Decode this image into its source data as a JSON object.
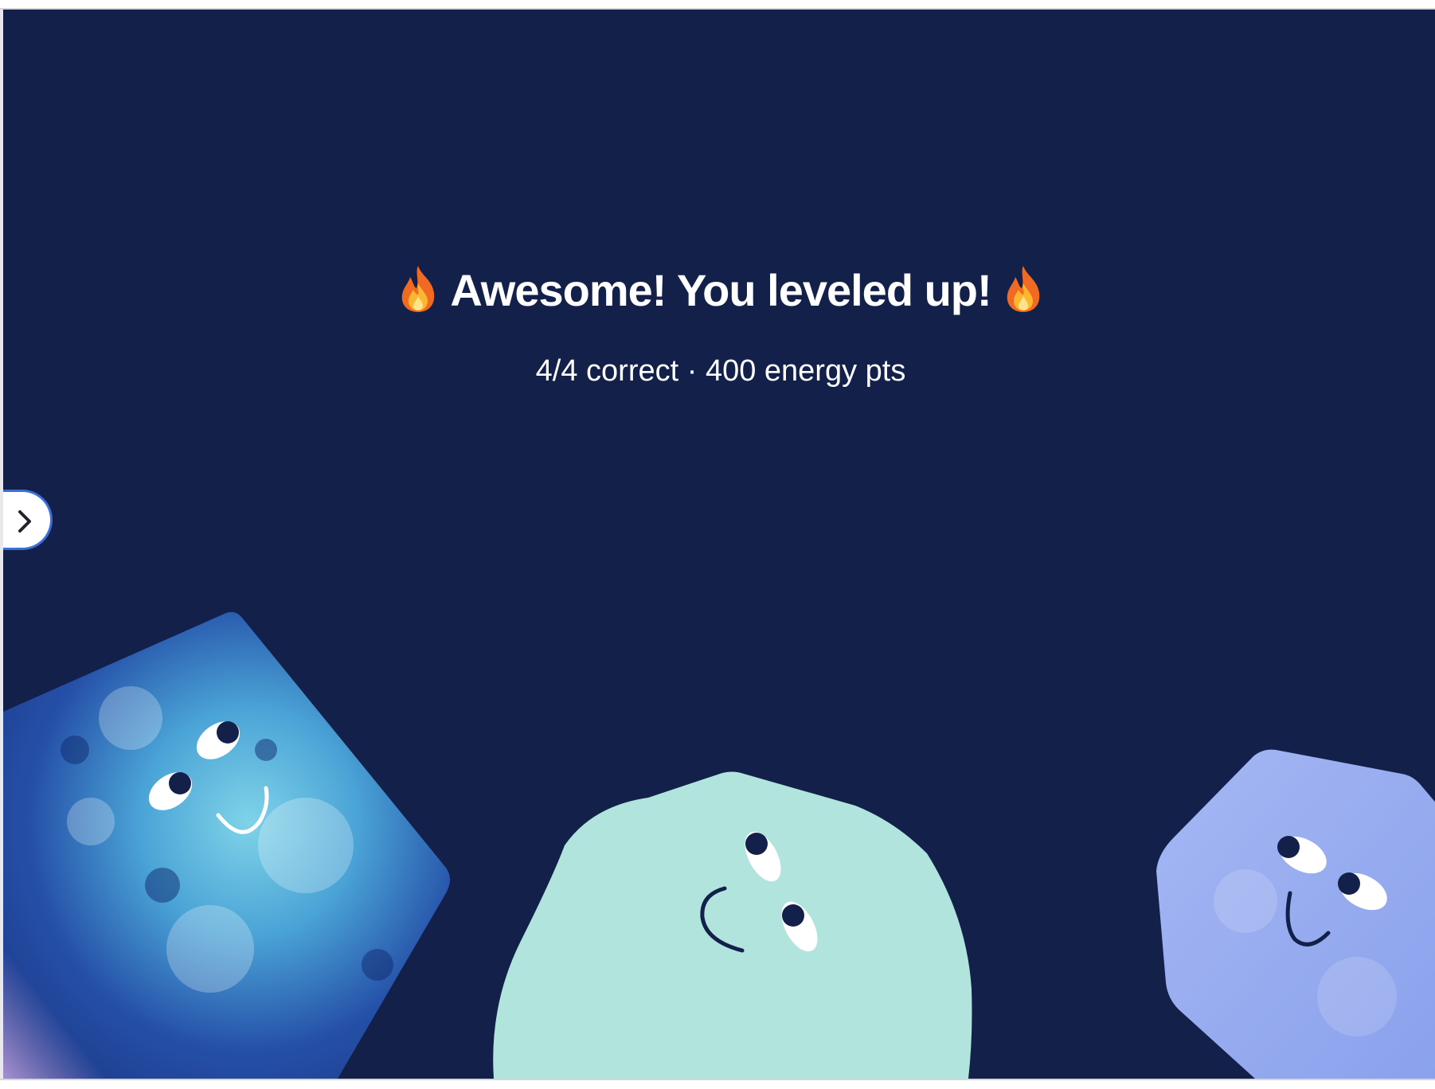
{
  "celebration": {
    "headline": "Awesome! You leveled up!",
    "summary": "4/4 correct · 400 energy pts"
  },
  "icons": {
    "headline_left": "fire-emoji-icon",
    "headline_right": "fire-emoji-icon",
    "side_toggle": "chevron-right-icon"
  },
  "colors": {
    "background": "#13204a",
    "text": "#ffffff",
    "toggle_border": "#3b6fd8",
    "mint_character": "#b1e4dc",
    "periwinkle_character": "#95abef",
    "blue_character": "#2d5cb8"
  }
}
